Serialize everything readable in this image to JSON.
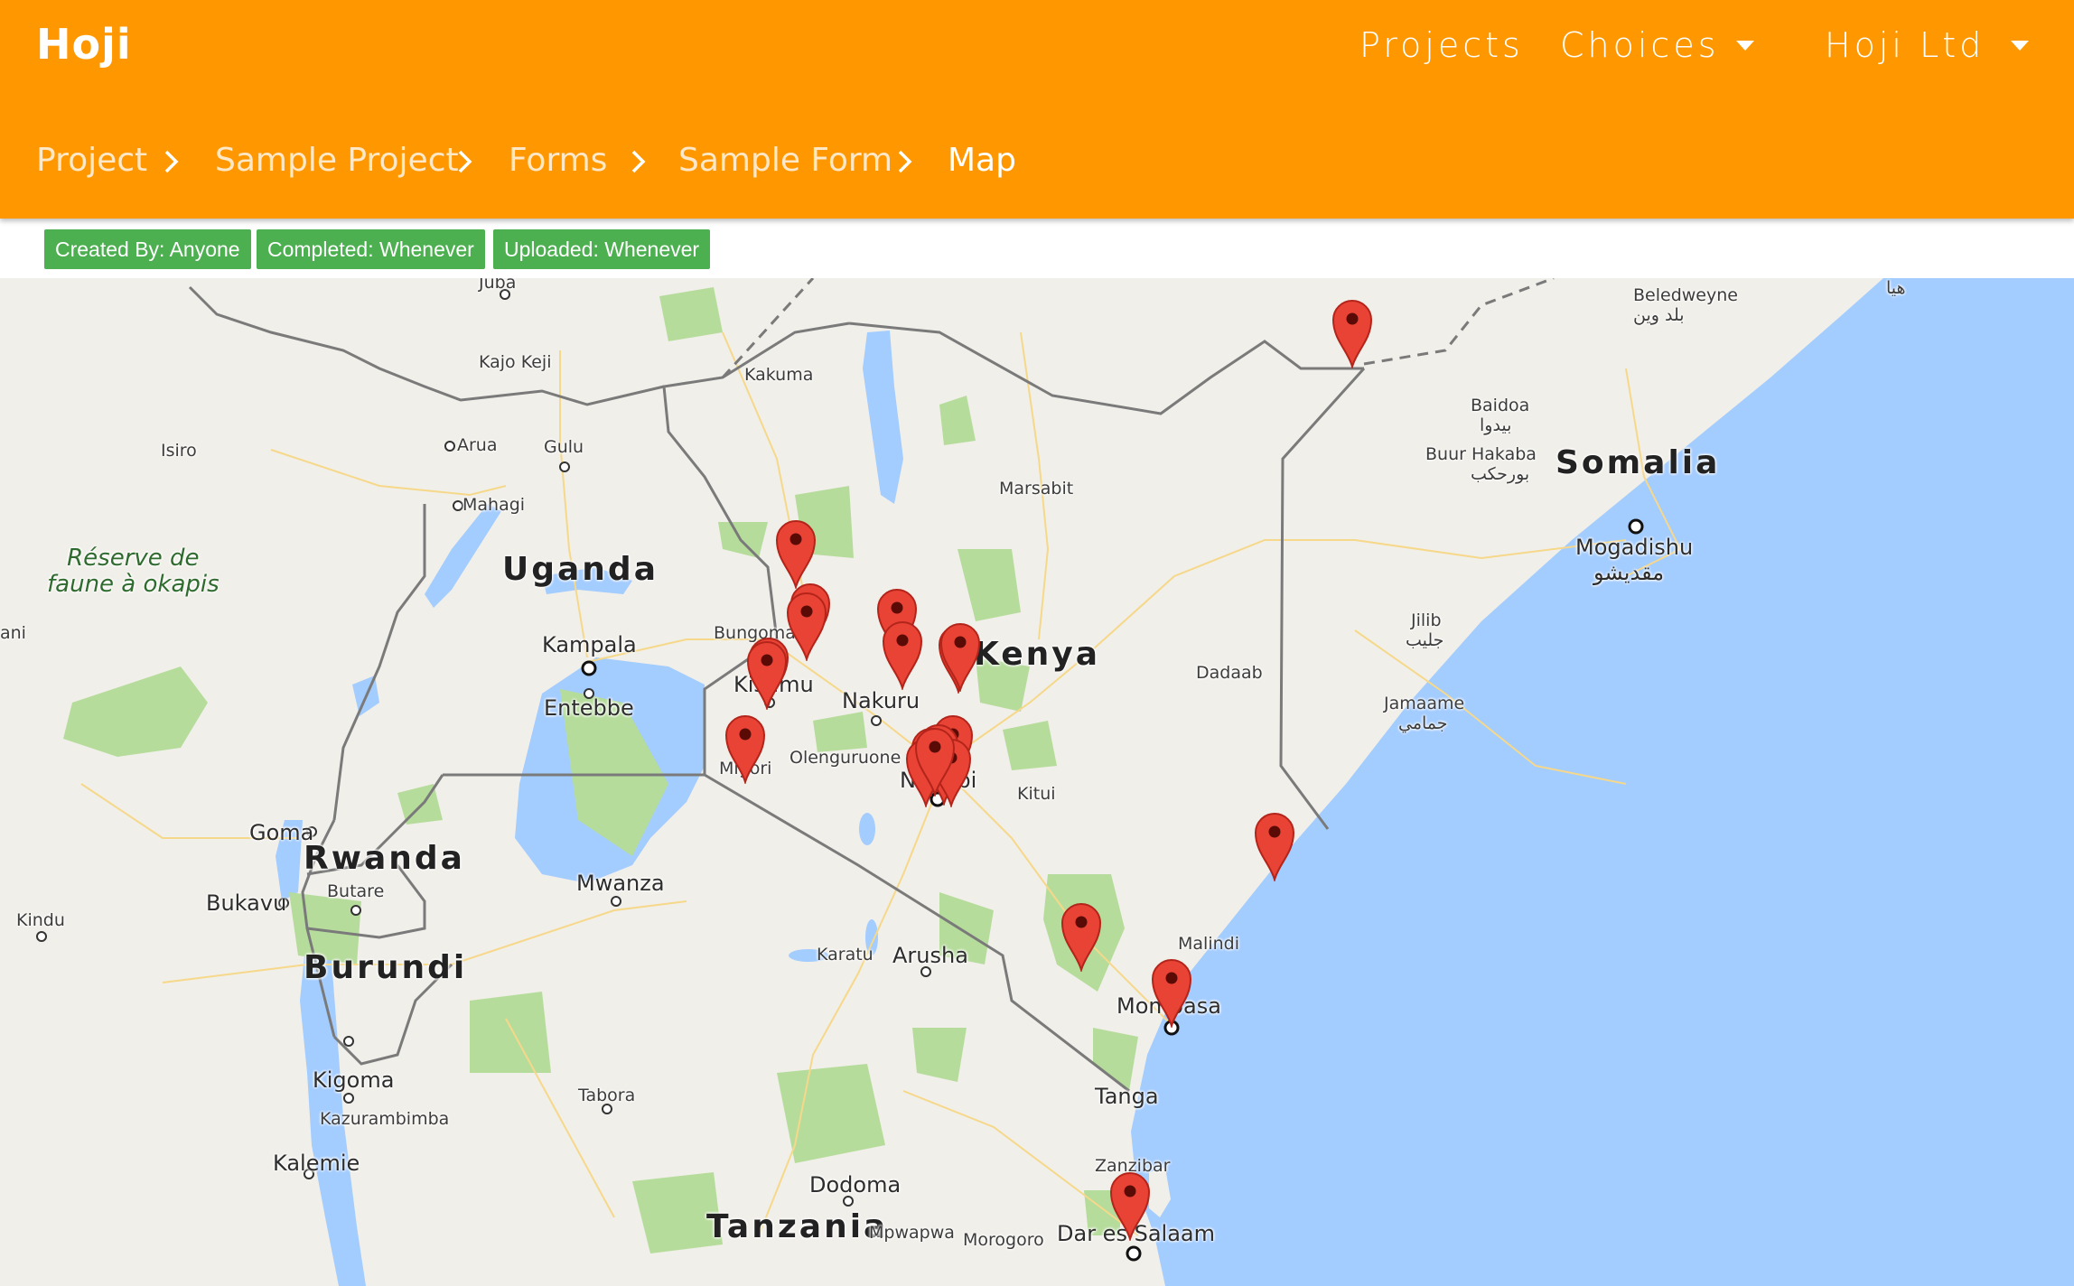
{
  "app": {
    "logo": "Hoji"
  },
  "nav": {
    "projects_label": "Projects",
    "choices_label": "Choices",
    "org_label": "Hoji Ltd"
  },
  "breadcrumb": [
    "Project",
    "Sample Project",
    "Forms",
    "Sample Form",
    "Map"
  ],
  "filters": {
    "created_by": "Created By: Anyone",
    "completed": "Completed: Whenever",
    "uploaded": "Uploaded: Whenever"
  },
  "map": {
    "countries": {
      "uganda": "Uganda",
      "kenya": "Kenya",
      "somalia": "Somalia",
      "rwanda": "Rwanda",
      "burundi": "Burundi",
      "tanzania": "Tanzania"
    },
    "park": {
      "line1": "Réserve de",
      "line2": "faune à okapis"
    },
    "places": {
      "juba": "Juba",
      "kajo_keji": "Kajo Keji",
      "kakuma": "Kakuma",
      "beledweyne": "Beledweyne",
      "beledweyne_ar": "بلد وين",
      "hiiraan_ar": "هيا",
      "baidoa": "Baidoa",
      "baidoa_ar": "بيدوا",
      "buur_hakaba": "Buur Hakaba",
      "buur_hakaba_ar": "بورحكب",
      "isiro": "Isiro",
      "arua": "Arua",
      "gulu": "Gulu",
      "mahagi": "Mahagi",
      "marsabit": "Marsabit",
      "mogadishu": "Mogadishu",
      "mogadishu_ar": "مقديشو",
      "jilib": "Jilib",
      "jilib_ar": "جليب",
      "ani": "ani",
      "kampala": "Kampala",
      "entebbe": "Entebbe",
      "bungoma": "Bungoma",
      "kisumu": "Kisumu",
      "nakuru": "Nakuru",
      "dadaab": "Dadaab",
      "jamaame": "Jamaame",
      "jamaame_ar": "جمامي",
      "migori": "Migori",
      "olenguruone": "Olenguruone",
      "nairobi": "Nairobi",
      "kitui": "Kitui",
      "goma": "Goma",
      "bukavu": "Bukavu",
      "butare": "Butare",
      "mwanza": "Mwanza",
      "kindu": "Kindu",
      "karatu": "Karatu",
      "arusha": "Arusha",
      "malindi": "Malindi",
      "mombasa": "Mombasa",
      "kigoma": "Kigoma",
      "kazurambimba": "Kazurambimba",
      "tabora": "Tabora",
      "tanga": "Tanga",
      "kalemie": "Kalemie",
      "zanzibar": "Zanzibar",
      "dodoma": "Dodoma",
      "mpwapwa": "Mpwapwa",
      "morogoro": "Morogoro",
      "dar_es_salaam": "Dar es Salaam"
    },
    "marker_count": 22
  },
  "colors": {
    "header": "#ff9800",
    "chip": "#4caf50",
    "water": "#a3ccff",
    "land": "#f1efe9",
    "parks": "#b6dc9c",
    "marker": "#e94335"
  },
  "icons": {
    "breadcrumb_separator": "chevron-right-icon",
    "dropdown": "caret-down-icon",
    "marker": "map-pin-icon"
  }
}
